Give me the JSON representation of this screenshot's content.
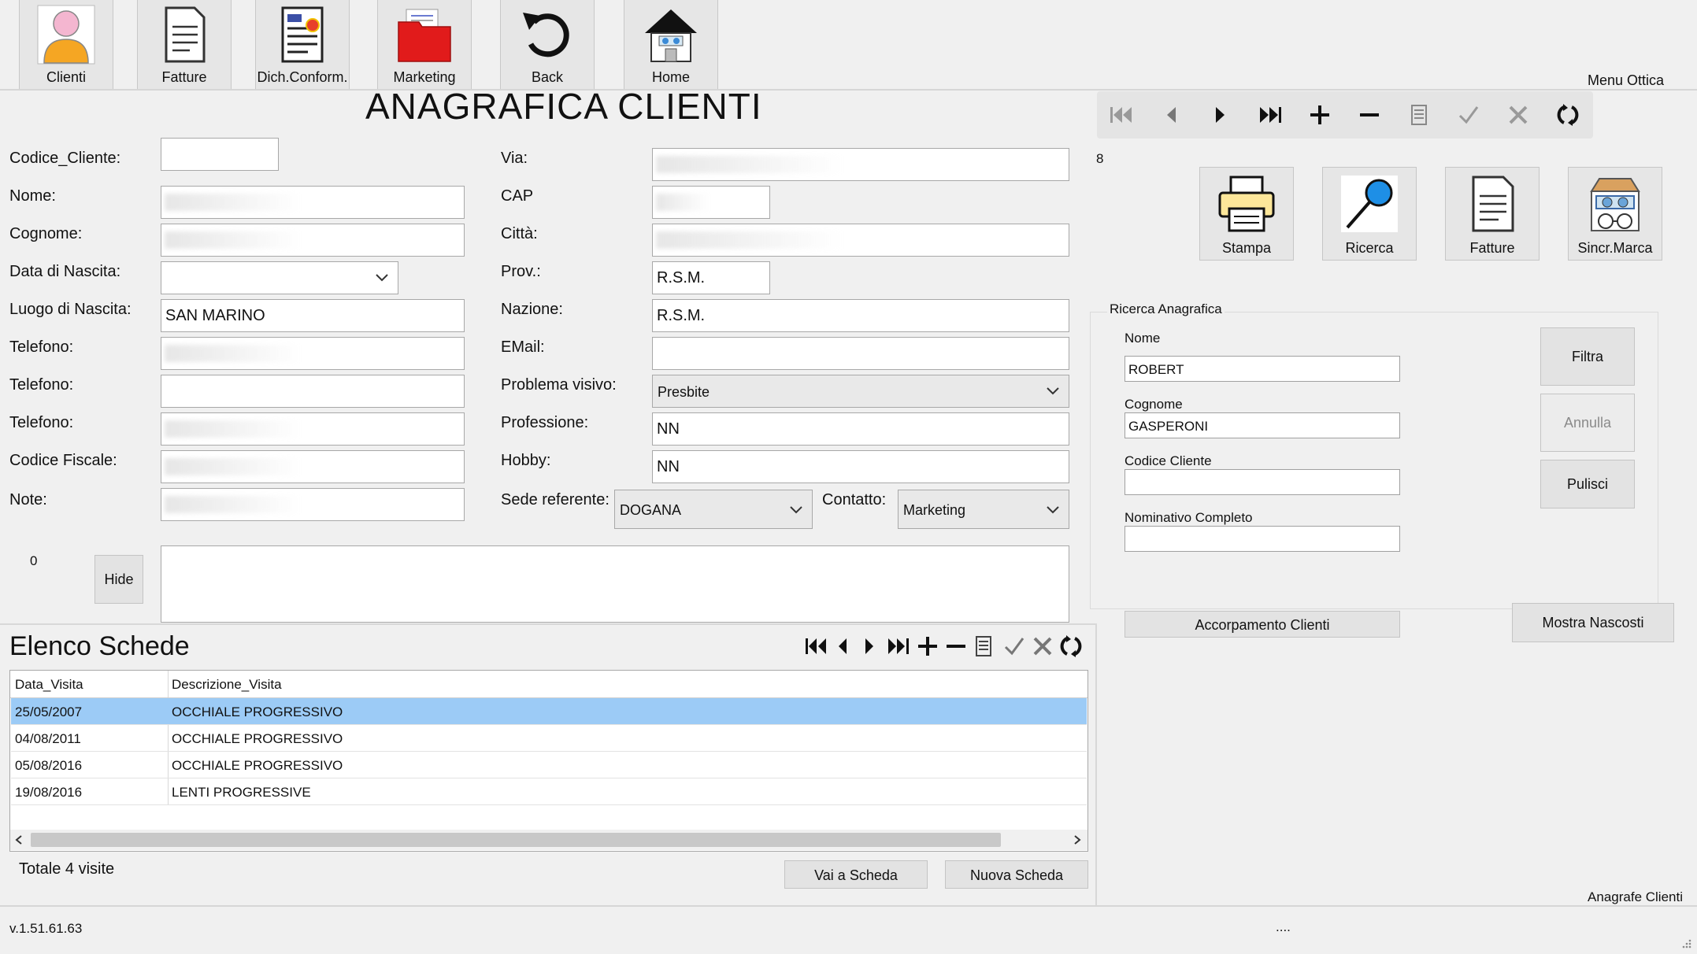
{
  "toolbar": {
    "items": [
      {
        "label": "Clienti",
        "icon": "user-icon"
      },
      {
        "label": "Fatture",
        "icon": "document-icon"
      },
      {
        "label": "Dich.Conform.",
        "icon": "certificate-icon"
      },
      {
        "label": "Marketing",
        "icon": "folder-icon"
      },
      {
        "label": "Back",
        "icon": "back-arrow-icon"
      },
      {
        "label": "Home",
        "icon": "home-icon"
      }
    ],
    "menu_label": "Menu Ottica"
  },
  "page_title": "ANAGRAFICA CLIENTI",
  "form": {
    "codice_cliente": {
      "label": "Codice_Cliente:",
      "value": ""
    },
    "nome": {
      "label": "Nome:",
      "value": ""
    },
    "cognome": {
      "label": "Cognome:",
      "value": ""
    },
    "data_nascita": {
      "label": "Data di Nascita:",
      "value": ""
    },
    "luogo_nascita": {
      "label": "Luogo di Nascita:",
      "value": "SAN MARINO"
    },
    "telefono1": {
      "label": "Telefono:",
      "value": ""
    },
    "telefono2": {
      "label": "Telefono:",
      "value": ""
    },
    "telefono3": {
      "label": "Telefono:",
      "value": ""
    },
    "codice_fiscale": {
      "label": "Codice Fiscale:",
      "value": ""
    },
    "note": {
      "label": "Note:",
      "value": ""
    },
    "via": {
      "label": "Via:",
      "value": ""
    },
    "cap": {
      "label": "CAP",
      "value": ""
    },
    "citta": {
      "label": "Città:",
      "value": ""
    },
    "prov": {
      "label": "Prov.:",
      "value": "R.S.M."
    },
    "nazione": {
      "label": "Nazione:",
      "value": "R.S.M."
    },
    "email": {
      "label": "EMail:",
      "value": ""
    },
    "problema_visivo": {
      "label": "Problema visivo:",
      "value": "Presbite"
    },
    "professione": {
      "label": "Professione:",
      "value": "NN"
    },
    "hobby": {
      "label": "Hobby:",
      "value": "NN"
    },
    "sede_referente": {
      "label": "Sede referente:",
      "value": "DOGANA"
    },
    "contatto": {
      "label": "Contatto:",
      "value": "Marketing"
    },
    "counter_zero": "0",
    "hide_label": "Hide",
    "record_count": "8"
  },
  "side_buttons": [
    {
      "label": "Stampa",
      "icon": "printer-icon"
    },
    {
      "label": "Ricerca",
      "icon": "magnifier-icon"
    },
    {
      "label": "Fatture",
      "icon": "document-icon"
    },
    {
      "label": "Sincr.Marca",
      "icon": "optician-shop-icon"
    }
  ],
  "ricerca": {
    "title": "Ricerca Anagrafica",
    "nome_label": "Nome",
    "nome_value": "ROBERT",
    "cognome_label": "Cognome",
    "cognome_value": "GASPERONI",
    "codice_label": "Codice Cliente",
    "codice_value": "",
    "nominativo_label": "Nominativo Completo",
    "nominativo_value": "",
    "filtra": "Filtra",
    "annulla": "Annulla",
    "pulisci": "Pulisci",
    "accorpamento": "Accorpamento Clienti",
    "mostra_nascosti": "Mostra Nascosti"
  },
  "schede": {
    "title": "Elenco Schede",
    "columns": [
      "Data_Visita",
      "Descrizione_Visita"
    ],
    "rows": [
      {
        "data": "25/05/2007",
        "descrizione": "OCCHIALE PROGRESSIVO"
      },
      {
        "data": "04/08/2011",
        "descrizione": "OCCHIALE PROGRESSIVO"
      },
      {
        "data": "05/08/2016",
        "descrizione": "OCCHIALE PROGRESSIVO"
      },
      {
        "data": "19/08/2016",
        "descrizione": "LENTI PROGRESSIVE"
      }
    ],
    "totale": "Totale 4 visite",
    "vai_scheda": "Vai a Scheda",
    "nuova_scheda": "Nuova Scheda"
  },
  "footer": {
    "version": "v.1.51.61.63",
    "center": "....",
    "right_label": "Anagrafe Clienti"
  }
}
